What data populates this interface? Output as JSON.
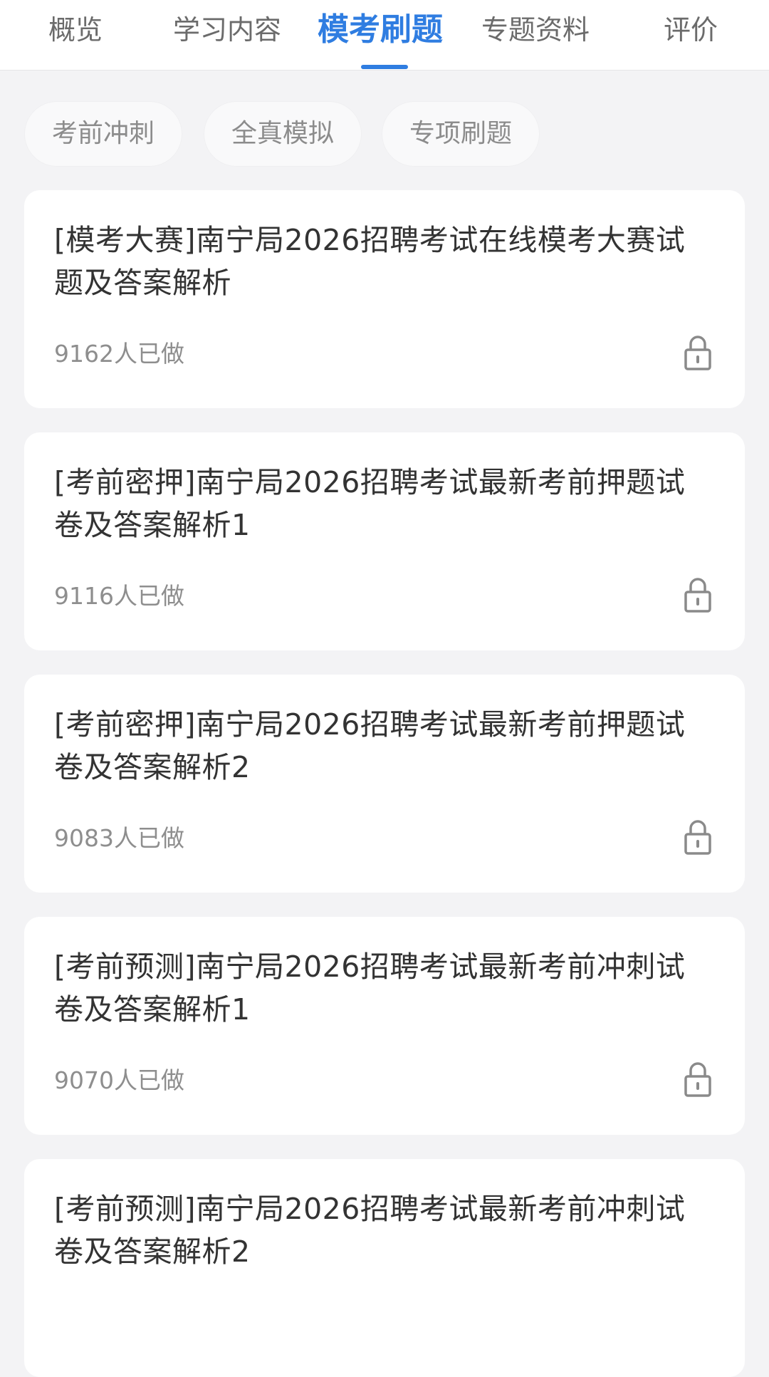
{
  "tabs": [
    {
      "label": "概览"
    },
    {
      "label": "学习内容"
    },
    {
      "label": "模考刷题"
    },
    {
      "label": "专题资料"
    },
    {
      "label": "评价"
    }
  ],
  "active_tab": "模考刷题",
  "filters": [
    {
      "label": "考前冲刺"
    },
    {
      "label": "全真模拟"
    },
    {
      "label": "专项刷题"
    }
  ],
  "exams": [
    {
      "title": "[模考大赛]南宁局2026招聘考试在线模考大赛试\n题及答案解析",
      "count": "9162人已做",
      "icon": "lock-icon"
    },
    {
      "title": "[考前密押]南宁局2026招聘考试最新考前押题试\n卷及答案解析1",
      "count": "9116人已做",
      "icon": "lock-icon"
    },
    {
      "title": "[考前密押]南宁局2026招聘考试最新考前押题试\n卷及答案解析2",
      "count": "9083人已做",
      "icon": "lock-icon"
    },
    {
      "title": "[考前预测]南宁局2026招聘考试最新考前冲刺试\n卷及答案解析1",
      "count": "9070人已做",
      "icon": "lock-icon"
    },
    {
      "title": "[考前预测]南宁局2026招聘考试最新考前冲刺试\n卷及答案解析2",
      "count": "",
      "icon": "lock-icon"
    }
  ],
  "colors": {
    "accent": "#2f7de1",
    "background": "#f3f3f5",
    "card": "#ffffff",
    "muted_text": "#8e8e8e"
  }
}
